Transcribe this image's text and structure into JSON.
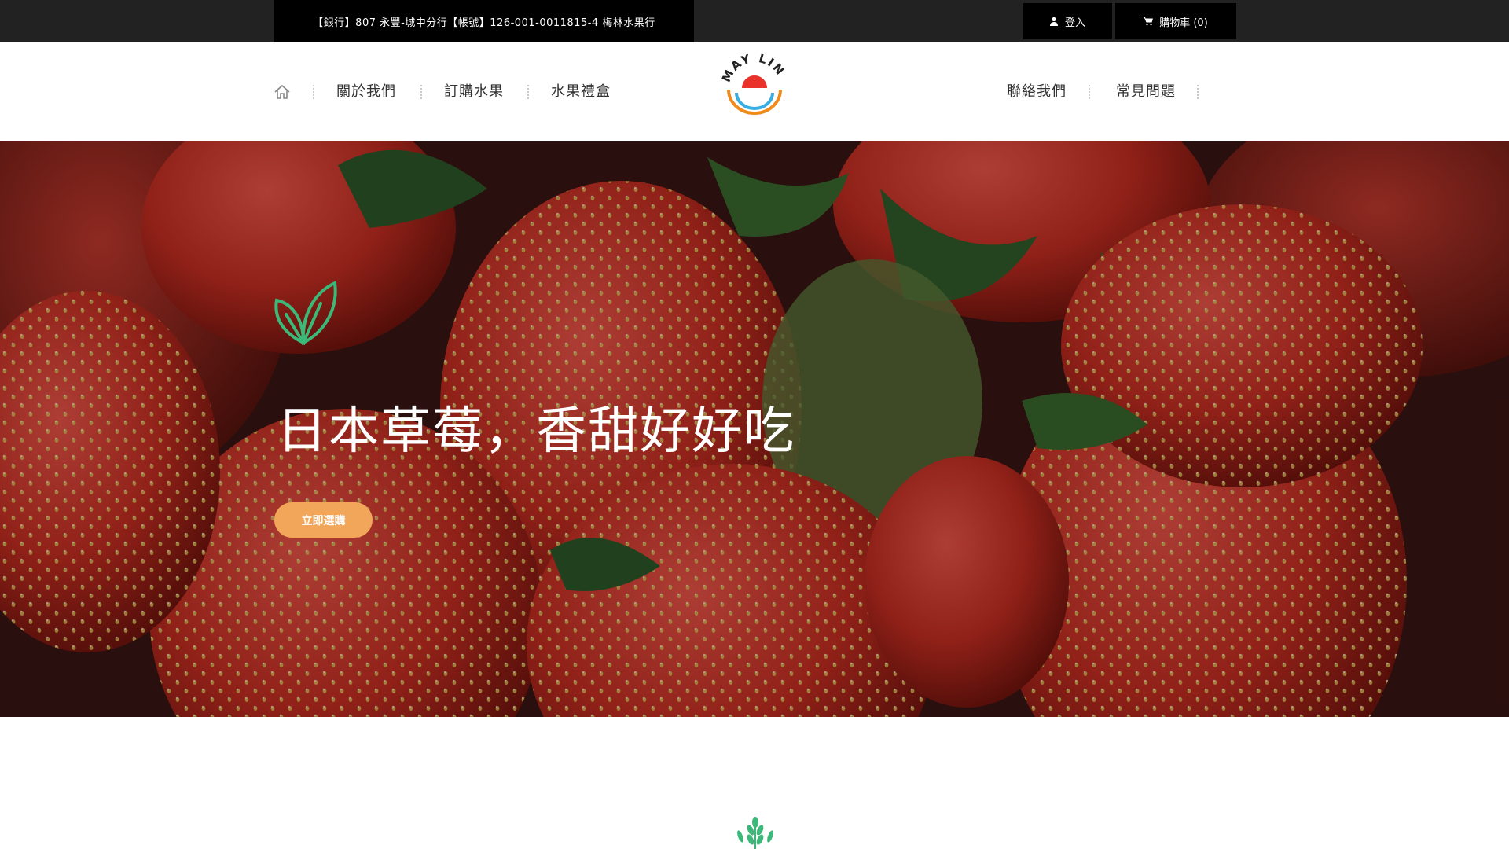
{
  "topbar": {
    "bank_info": "【銀行】807 永豐-城中分行【帳號】126-001-0011815-4 梅林水果行",
    "login_label": "登入",
    "cart_label": "購物車 (0)",
    "login_icon": "user-icon",
    "cart_icon": "cart-icon"
  },
  "nav": {
    "home_icon": "home-icon",
    "left_items": [
      "關於我們",
      "訂購水果",
      "水果禮盒"
    ],
    "right_items": [
      "聯絡我們",
      "常見問題"
    ]
  },
  "logo": {
    "text": "MAY LIN",
    "colors": {
      "sun": "#e8322a",
      "inner_arc": "#3aaee0",
      "outer_arc": "#f08a1c"
    }
  },
  "hero": {
    "headline": "日本草莓，香甜好好吃",
    "cta_label": "立即選購",
    "leaf_icon": "leaf-icon",
    "accent": "#f2a65a"
  },
  "section": {
    "wheat_icon": "wheat-icon"
  }
}
